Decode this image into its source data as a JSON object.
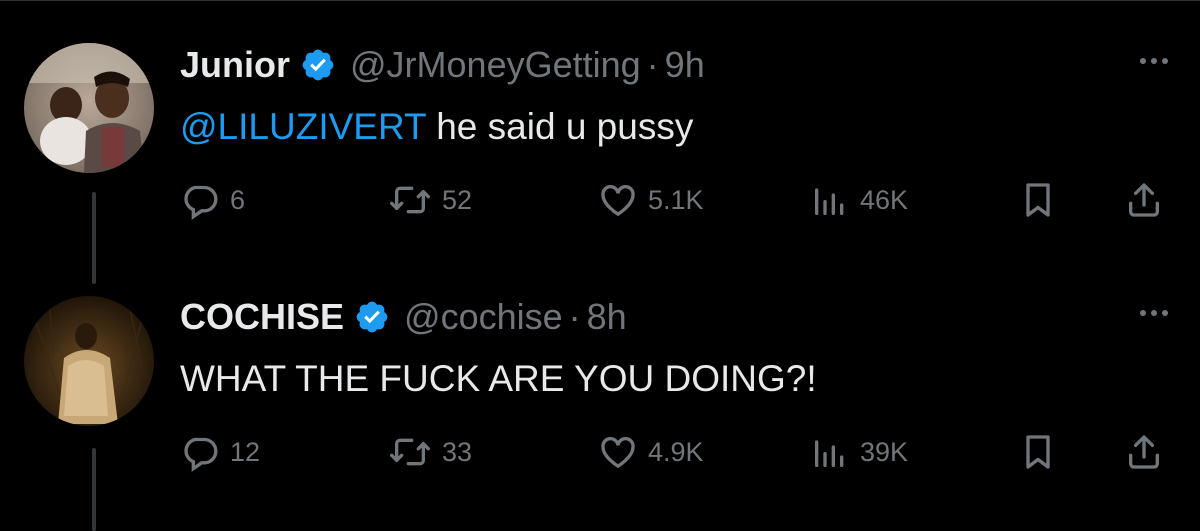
{
  "tweets": [
    {
      "name": "Junior",
      "handle": "@JrMoneyGetting",
      "separator": "·",
      "time": "9h",
      "text_mention": "@LILUZIVERT",
      "text_body": " he said u pussy",
      "replies": "6",
      "retweets": "52",
      "likes": "5.1K",
      "views": "46K",
      "verified_color": "#1d9bf0"
    },
    {
      "name": "COCHISE",
      "handle": "@cochise",
      "separator": "·",
      "time": "8h",
      "text_mention": "",
      "text_body": "WHAT THE FUCK ARE YOU DOING?!",
      "replies": "12",
      "retweets": "33",
      "likes": "4.9K",
      "views": "39K",
      "verified_color": "#1d9bf0"
    }
  ],
  "icons": {
    "reply": "reply-icon",
    "retweet": "retweet-icon",
    "like": "heart-icon",
    "views": "views-icon",
    "bookmark": "bookmark-icon",
    "share": "share-icon",
    "more": "more-icon",
    "verified": "verified-badge-icon"
  },
  "colors": {
    "background": "#000000",
    "text": "#e7e9ea",
    "muted": "#71767b",
    "accent": "#1d9bf0"
  }
}
